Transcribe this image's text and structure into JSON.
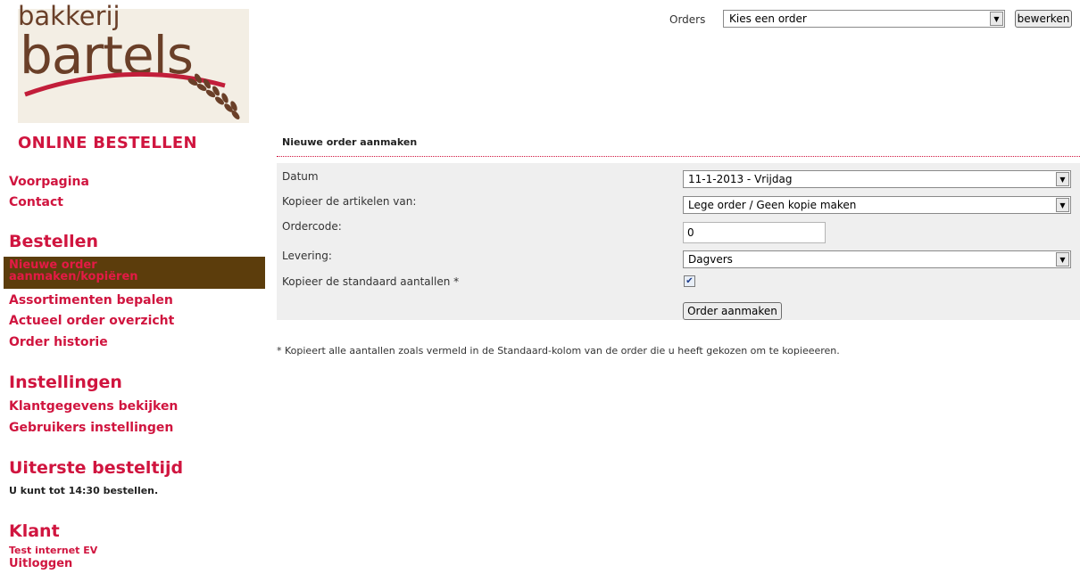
{
  "logo": {
    "line1": "bakkerij",
    "line2": "bartels"
  },
  "tagline": "ONLINE BESTELLEN",
  "nav": {
    "voorpagina": "Voorpagina",
    "contact": "Contact",
    "bestellen_heading": "Bestellen",
    "nieuwe_order": "Nieuwe order aanmaken/kopiëren",
    "assortimenten": "Assortimenten bepalen",
    "actueel": "Actueel order overzicht",
    "historie": "Order historie",
    "instellingen_heading": "Instellingen",
    "klantgegevens": "Klantgegevens bekijken",
    "gebruikers": "Gebruikers instellingen",
    "besteltijd_heading": "Uiterste besteltijd",
    "besteltijd_text": "U kunt tot 14:30 bestellen.",
    "klant_heading": "Klant",
    "klant_name": "Test internet EV",
    "uitloggen": "Uitloggen"
  },
  "topbar": {
    "orders_label": "Orders",
    "orders_selected": "Kies een order",
    "edit_button": "bewerken"
  },
  "form": {
    "title": "Nieuwe order aanmaken",
    "datum_label": "Datum",
    "datum_value": "11-1-2013 - Vrijdag",
    "kopieer_label": "Kopieer de artikelen van:",
    "kopieer_value": "Lege order / Geen kopie maken",
    "ordercode_label": "Ordercode:",
    "ordercode_value": "0",
    "levering_label": "Levering:",
    "levering_value": "Dagvers",
    "standaard_label": "Kopieer de standaard aantallen *",
    "standaard_checked": true,
    "submit_label": "Order aanmaken",
    "footnote": "* Kopieert alle aantallen zoals vermeld in de Standaard-kolom van de order die u heeft gekozen om te kopieeeren."
  },
  "colors": {
    "accent": "#d0153f",
    "active_bg": "#5c3d0c",
    "panel_bg": "#efefef",
    "logo_brown": "#6a3f28"
  }
}
